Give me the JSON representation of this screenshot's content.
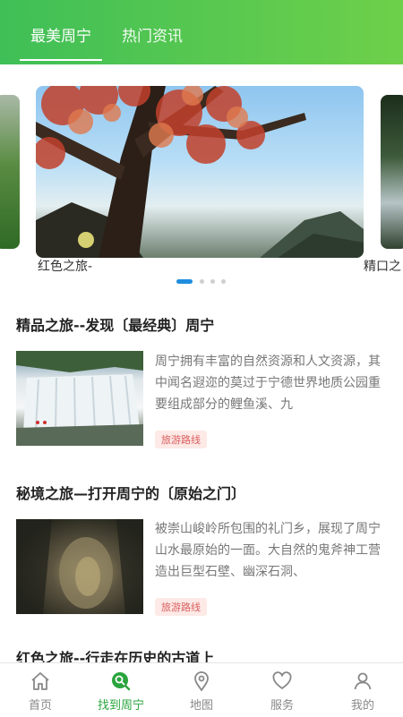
{
  "header": {
    "tabs": [
      {
        "label": "最美周宁",
        "active": true
      },
      {
        "label": "热门资讯",
        "active": false
      }
    ]
  },
  "carousel": {
    "captions": {
      "main": "红色之旅-",
      "next": "精口之"
    },
    "dot_count": 4,
    "active_dot": 1
  },
  "articles": [
    {
      "title": "精品之旅--发现〔最经典〕周宁",
      "description": "周宁拥有丰富的自然资源和人文资源，其中闻名遐迩的莫过于宁德世界地质公园重要组成部分的鲤鱼溪、九",
      "tag": "旅游路线"
    },
    {
      "title": "秘境之旅—打开周宁的〔原始之门〕",
      "description": "被崇山峻岭所包围的礼门乡，展现了周宁山水最原始的一面。大自然的鬼斧神工营造出巨型石壁、幽深石洞、",
      "tag": "旅游路线"
    },
    {
      "title": "红色之旅--行走在历史的古道上",
      "description": "",
      "tag": ""
    }
  ],
  "bottom_nav": [
    {
      "label": "首页",
      "icon": "home-icon"
    },
    {
      "label": "找到周宁",
      "icon": "find-icon",
      "active": true
    },
    {
      "label": "地图",
      "icon": "map-pin-icon"
    },
    {
      "label": "服务",
      "icon": "heart-icon"
    },
    {
      "label": "我的",
      "icon": "person-icon"
    }
  ],
  "colors": {
    "header_start": "#3fbf57",
    "header_end": "#6ed04a",
    "active_nav": "#2aa43d",
    "tag_text": "#d95f5f",
    "tag_bg": "#fde9e6",
    "dot_active": "#1f8ddf"
  }
}
